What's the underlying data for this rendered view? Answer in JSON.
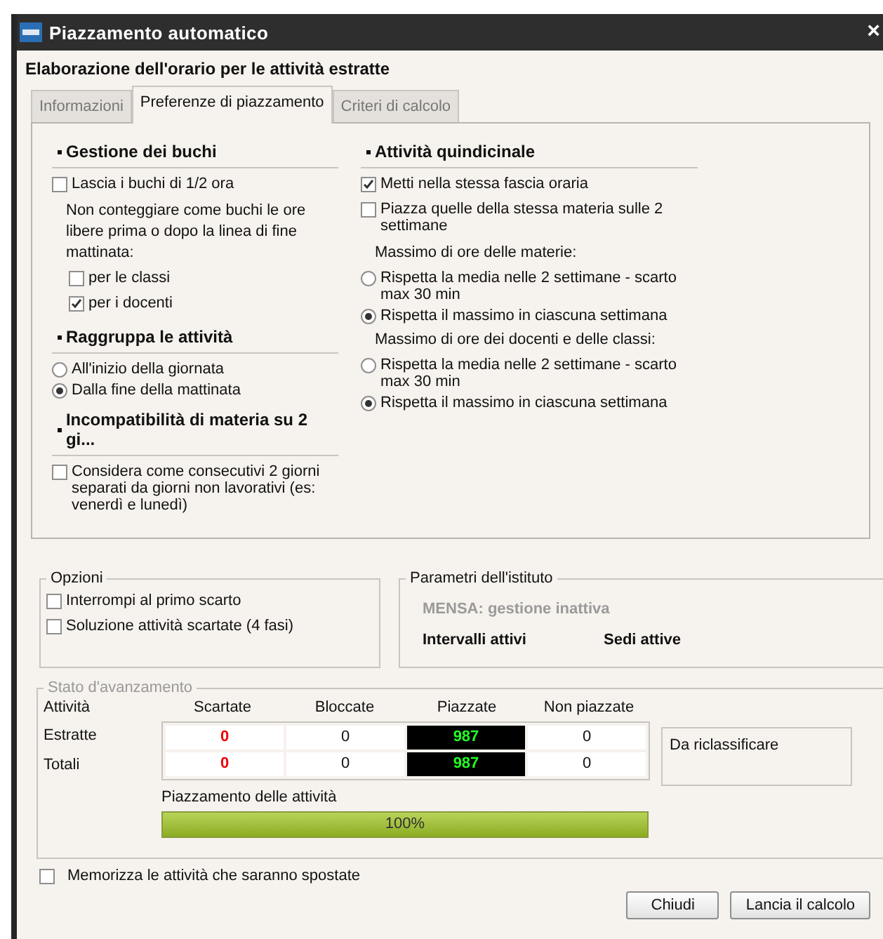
{
  "window": {
    "title": "Piazzamento automatico",
    "close": "×"
  },
  "heading": "Elaborazione dell'orario per le attività estratte",
  "tabs": [
    {
      "label": "Informazioni",
      "selected": false
    },
    {
      "label": "Preferenze di piazzamento",
      "selected": true
    },
    {
      "label": "Criteri di calcolo",
      "selected": false
    }
  ],
  "left_sections": [
    {
      "title": "Gestione dei buchi",
      "items": [
        {
          "kind": "checkbox",
          "label": "Lascia i buchi di 1/2 ora",
          "checked": false
        },
        {
          "kind": "note",
          "label": "Non conteggiare come buchi le ore libere prima o dopo la linea di fine mattinata:",
          "children": [
            {
              "label": "per le classi",
              "checked": false
            },
            {
              "label": "per i docenti",
              "checked": true
            }
          ]
        }
      ]
    },
    {
      "title": "Raggruppa le attività",
      "items": [
        {
          "kind": "radio",
          "label": "All'inizio della giornata",
          "selected": false
        },
        {
          "kind": "radio",
          "label": "Dalla fine della mattinata",
          "selected": true
        }
      ]
    },
    {
      "title": "Incompatibilità di materia su 2 gi...",
      "items": [
        {
          "kind": "checkbox",
          "label": "Considera come consecutivi 2 giorni separati da giorni non lavorativi (es: venerdì e lunedì)",
          "checked": false
        }
      ]
    }
  ],
  "right_sections": [
    {
      "title": "Attività quindicinale",
      "items": [
        {
          "kind": "checkbox",
          "label": "Metti nella stessa fascia oraria",
          "checked": true
        },
        {
          "kind": "checkbox",
          "label": "Piazza quelle della stessa materia sulle 2 settimane",
          "checked": false
        },
        {
          "kind": "note",
          "label": "Massimo di ore delle materie:"
        },
        {
          "kind": "radio",
          "label": "Rispetta la media nelle 2 settimane - scarto max 30 min",
          "selected": false
        },
        {
          "kind": "radio",
          "label": "Rispetta il massimo in ciascuna settimana",
          "selected": true
        },
        {
          "kind": "note",
          "label": "Massimo di ore dei docenti e delle classi:"
        },
        {
          "kind": "radio",
          "label": "Rispetta la media nelle 2 settimane - scarto max 30 min",
          "selected": false
        },
        {
          "kind": "radio",
          "label": "Rispetta il massimo in ciascuna settimana",
          "selected": true
        }
      ]
    }
  ],
  "options": {
    "title": "Opzioni",
    "items": [
      {
        "label": "Interrompi al primo scarto",
        "checked": false
      },
      {
        "label": "Soluzione attività scartate (4 fasi)",
        "checked": false
      }
    ]
  },
  "institute": {
    "title": "Parametri dell'istituto",
    "status": "MENSA: gestione inattiva",
    "labels": [
      "Intervalli attivi",
      "Sedi attive"
    ]
  },
  "progress": {
    "title": "Stato d'avanzamento",
    "row_header": "Attività",
    "columns": [
      {
        "label": "Scartate",
        "kind": "alert"
      },
      {
        "label": "Bloccate",
        "kind": "plain"
      },
      {
        "label": "Piazzate",
        "kind": "highlight"
      },
      {
        "label": "Non piazzate",
        "kind": "plain"
      }
    ],
    "rows": [
      {
        "label": "Estratte",
        "values": [
          "0",
          "0",
          "987",
          "0"
        ]
      },
      {
        "label": "Totali",
        "values": [
          "0",
          "0",
          "987",
          "0"
        ]
      }
    ],
    "side_note": "Da riclassificare",
    "bar": {
      "label": "Piazzamento delle attività",
      "level": 1,
      "reading": "100%"
    }
  },
  "footer_option": {
    "label": "Memorizza le attività che saranno spostate",
    "checked": false
  },
  "buttons": [
    "Chiudi",
    "Lancia il calcolo"
  ]
}
